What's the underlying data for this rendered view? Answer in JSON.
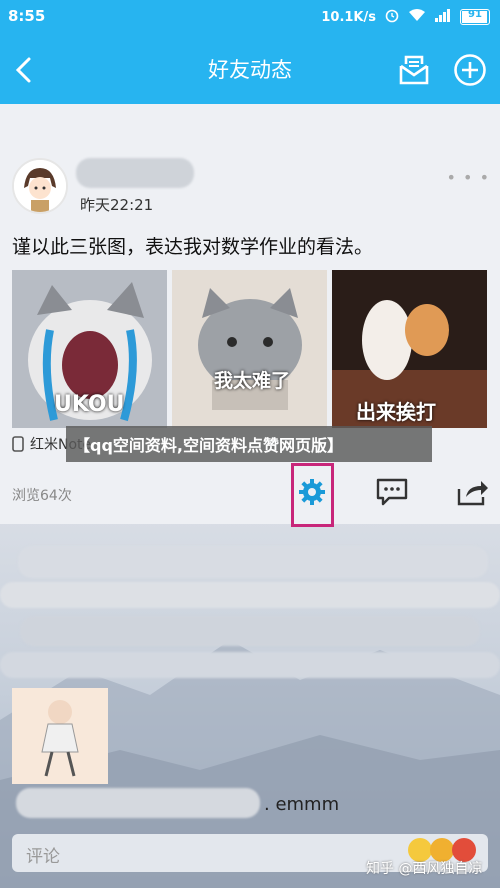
{
  "status_bar": {
    "time": "8:55",
    "network_speed": "10.1K/s",
    "battery_level": "91"
  },
  "header": {
    "title": "好友动态"
  },
  "post": {
    "time": "昨天22:21",
    "text": "谨以此三张图，表达我对数学作业的看法。",
    "images": [
      {
        "caption": "UKOU",
        "icon": "crying-cat-image"
      },
      {
        "caption": "我太难了",
        "icon": "sad-cat-image"
      },
      {
        "caption": "出来挨打",
        "icon": "cats-fighting-image"
      }
    ],
    "device": "红米Note",
    "views": "浏览64次"
  },
  "overlay_title": "【qq空间资料,空间资料点赞网页版】",
  "comment_preview": {
    "text": ". emmm"
  },
  "comment_input": {
    "placeholder": "评论"
  },
  "watermark": "知乎 @西风独自凉",
  "colors": {
    "primary": "#27b4f0",
    "highlight_box": "#c8267a",
    "action_icon": "#1a9ad8"
  }
}
